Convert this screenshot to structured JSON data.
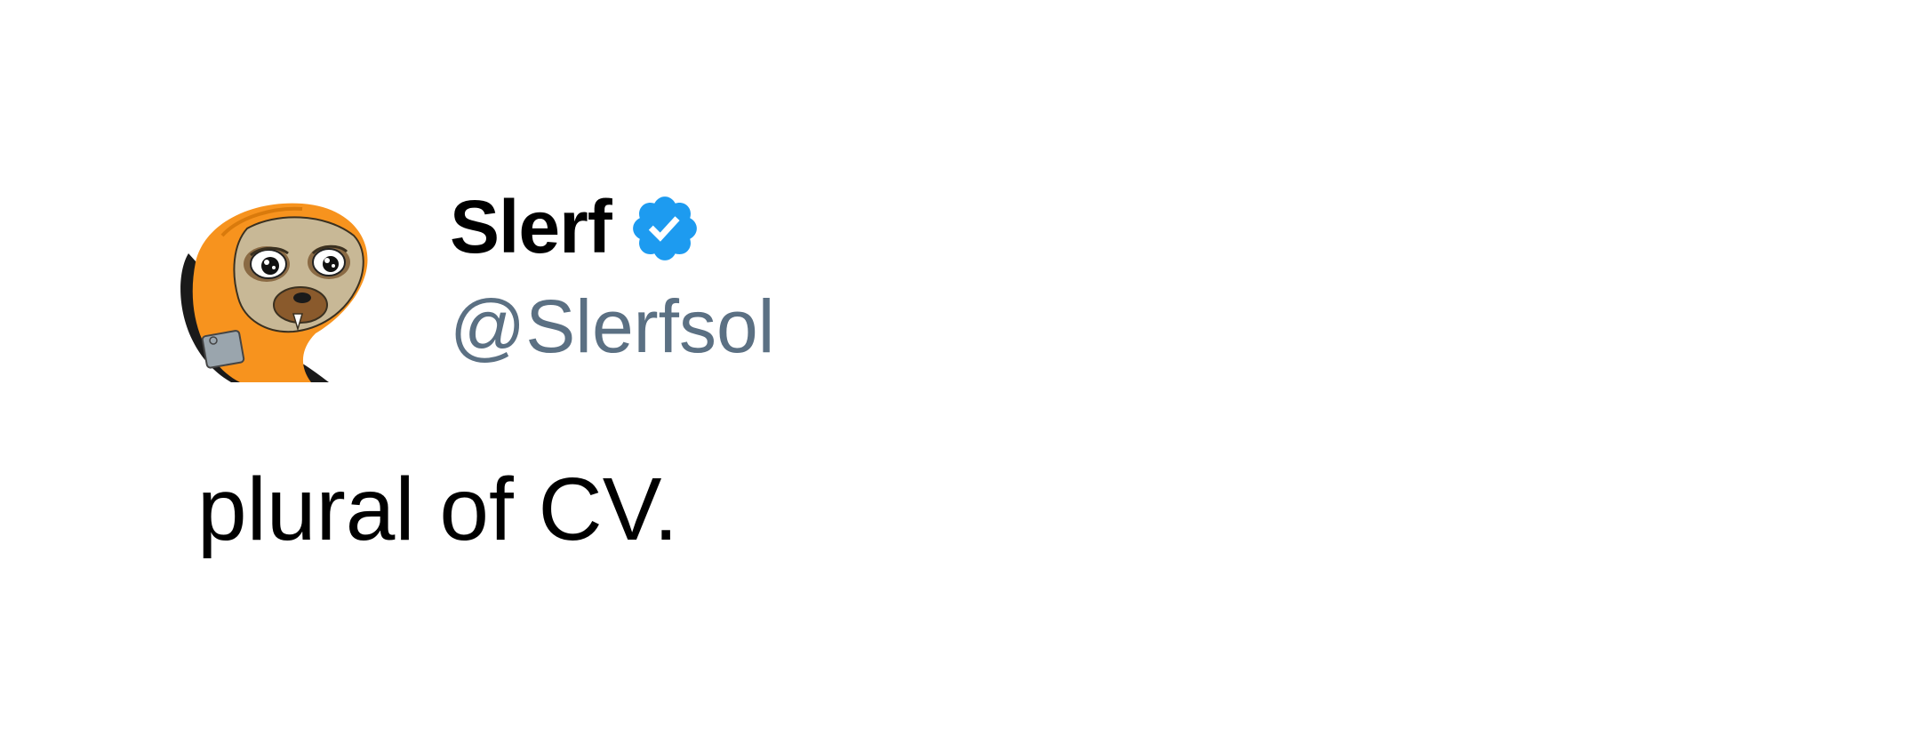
{
  "author": {
    "display_name": "Slerf",
    "handle": "@Slerfsol",
    "verified": true,
    "avatar_icon": "orange-hooded-sloth-avatar"
  },
  "tweet": {
    "text": "plural of CV."
  },
  "colors": {
    "background": "#ffffff",
    "name": "#000000",
    "handle": "#5b7083",
    "verified_badge": "#1d9bf0",
    "avatar_hood": "#f7931e",
    "avatar_face": "#c8b896"
  }
}
